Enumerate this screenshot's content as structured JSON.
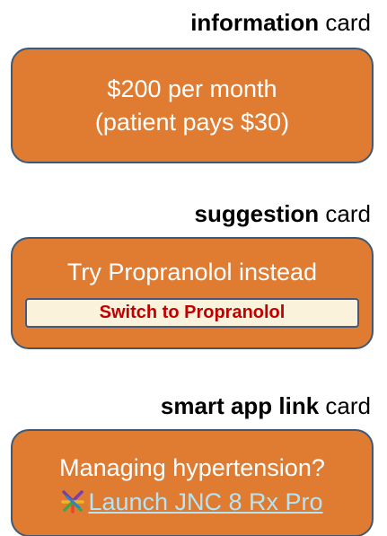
{
  "colors": {
    "card_fill": "#df7c32",
    "card_border": "#3c5a78",
    "button_fill": "#fbf2dc",
    "button_text": "#c00000",
    "link_text": "#b3e4f5"
  },
  "information": {
    "heading_strong": "information",
    "heading_rest": " card",
    "line1": "$200 per month",
    "line2": "(patient pays $30)"
  },
  "suggestion": {
    "heading_strong": "suggestion",
    "heading_rest": " card",
    "text": "Try Propranolol instead",
    "button_label": "Switch to Propranolol"
  },
  "smart_app_link": {
    "heading_strong": "smart app link",
    "heading_rest": " card",
    "text": "Managing hypertension?",
    "link_label": "Launch JNC 8 Rx Pro",
    "icon": "app-logo-icon"
  }
}
